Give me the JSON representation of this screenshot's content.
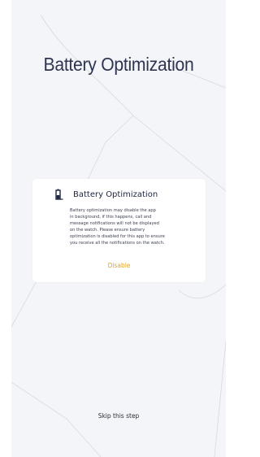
{
  "page": {
    "title": "Battery Optimization",
    "skip_label": "Skip this step"
  },
  "card": {
    "icon": "battery-icon",
    "title": "Battery Optimization",
    "body": "Battery optimization may disable the app\nin background, if this happens, call and\nmessage notifications will not be displayed\non the watch. Please ensure battery\noptimization is disabled for this app to ensure\nyou receive all the notifications on the watch.",
    "action_label": "Disable"
  },
  "colors": {
    "background": "#f4f5f8",
    "title": "#2f3550",
    "accent": "#e7a31b"
  }
}
